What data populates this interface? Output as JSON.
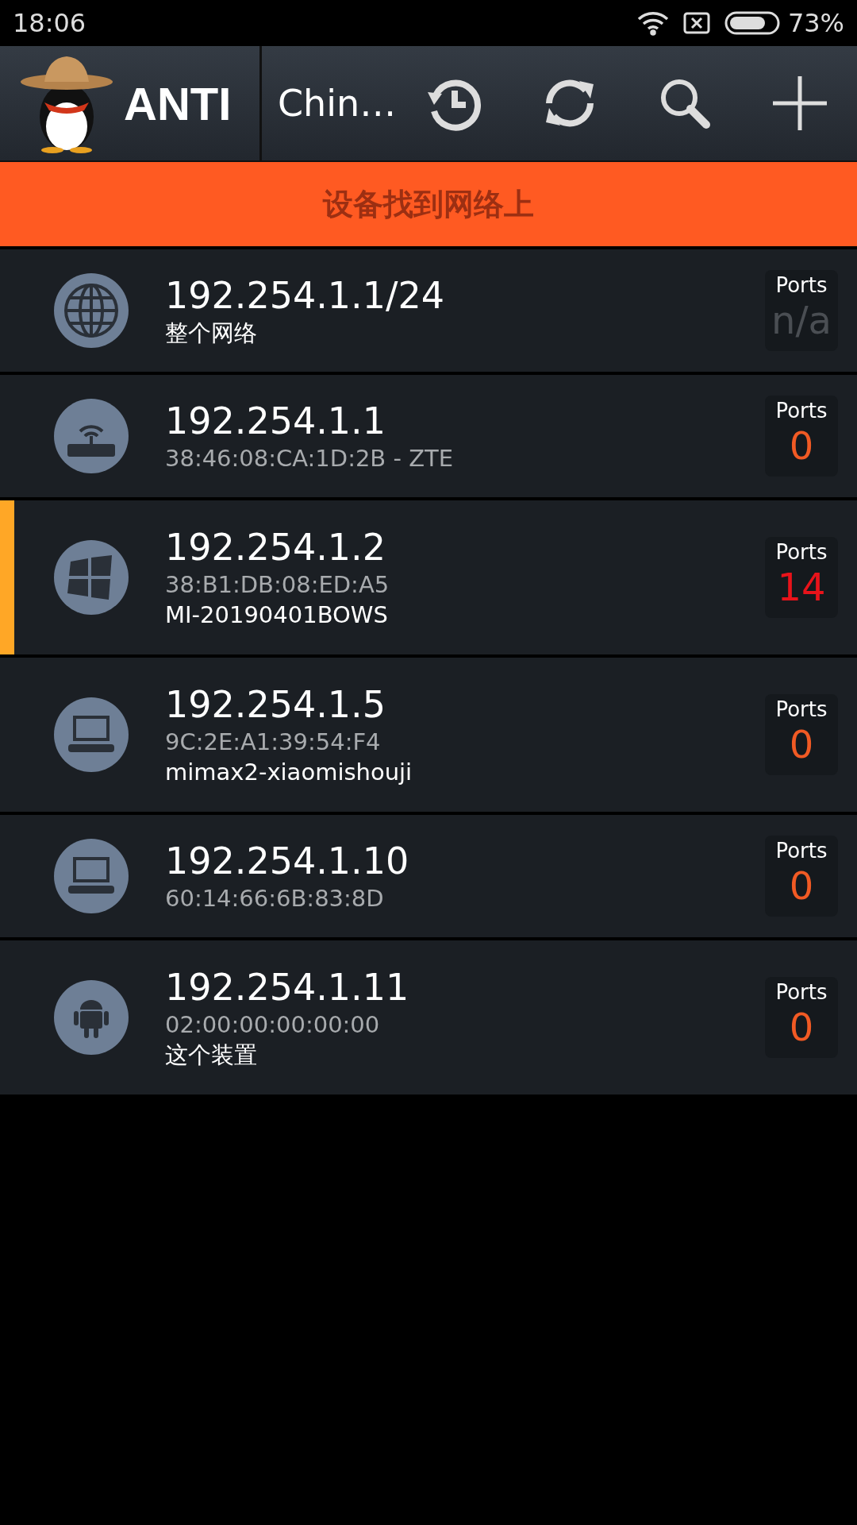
{
  "status_bar": {
    "time": "18:06",
    "battery": "73%"
  },
  "toolbar": {
    "app_name": "ANTI",
    "network": "Chin…"
  },
  "banner": "设备找到网络上",
  "devices": [
    {
      "kind": "network",
      "ip": "192.254.1.1/24",
      "lines": [
        {
          "text": "整个网络",
          "kind": "name"
        }
      ],
      "ports_label": "Ports",
      "ports": "n/a",
      "color": "#4a4e53",
      "selected": false
    },
    {
      "kind": "router",
      "ip": "192.254.1.1",
      "lines": [
        {
          "text": "38:46:08:CA:1D:2B - ZTE",
          "kind": "mac"
        }
      ],
      "ports_label": "Ports",
      "ports": "0",
      "color": "#f15a24",
      "selected": false
    },
    {
      "kind": "windows",
      "ip": "192.254.1.2",
      "lines": [
        {
          "text": "38:B1:DB:08:ED:A5",
          "kind": "mac"
        },
        {
          "text": "MI-20190401BOWS",
          "kind": "name"
        }
      ],
      "ports_label": "Ports",
      "ports": "14",
      "color": "#e8131a",
      "selected": true
    },
    {
      "kind": "computer",
      "ip": "192.254.1.5",
      "lines": [
        {
          "text": "9C:2E:A1:39:54:F4",
          "kind": "mac"
        },
        {
          "text": "mimax2-xiaomishouji",
          "kind": "name"
        }
      ],
      "ports_label": "Ports",
      "ports": "0",
      "color": "#f15a24",
      "selected": false
    },
    {
      "kind": "computer",
      "ip": "192.254.1.10",
      "lines": [
        {
          "text": "60:14:66:6B:83:8D",
          "kind": "mac"
        }
      ],
      "ports_label": "Ports",
      "ports": "0",
      "color": "#f15a24",
      "selected": false
    },
    {
      "kind": "android",
      "ip": "192.254.1.11",
      "lines": [
        {
          "text": "02:00:00:00:00:00",
          "kind": "mac"
        },
        {
          "text": "这个装置",
          "kind": "name"
        }
      ],
      "ports_label": "Ports",
      "ports": "0",
      "color": "#f15a24",
      "selected": false
    }
  ]
}
